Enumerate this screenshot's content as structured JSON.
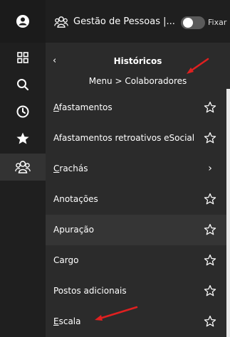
{
  "rail": {
    "items": [
      {
        "name": "profile-icon"
      },
      {
        "name": "apps-grid-icon"
      },
      {
        "name": "search-icon"
      },
      {
        "name": "history-clock-icon"
      },
      {
        "name": "favorites-star-icon"
      },
      {
        "name": "people-group-icon"
      }
    ]
  },
  "header": {
    "app_title": "Gestão de Pessoas |...",
    "pin_label": "Fixar"
  },
  "nav": {
    "back": "‹",
    "title": "Históricos",
    "breadcrumb": "Menu  > Colaboradores"
  },
  "menu": {
    "items": [
      {
        "first": "A",
        "rest": "fastamentos",
        "action": "star-outline-icon"
      },
      {
        "first": "",
        "rest": "Afastamentos retroativos eSocial",
        "action": "star-outline-icon"
      },
      {
        "first": "C",
        "rest": "rachás",
        "action": "chevron-right-icon",
        "chevron": "›"
      },
      {
        "first": "",
        "rest": "Anotações",
        "action": "star-outline-icon"
      },
      {
        "first": "",
        "rest": "Apuração",
        "action": "star-outline-icon",
        "active": true
      },
      {
        "first": "",
        "rest": "Cargo",
        "action": "star-outline-icon"
      },
      {
        "first": "",
        "rest": "Postos adicionais",
        "action": "star-outline-icon"
      },
      {
        "first": "E",
        "rest": "scala",
        "action": "star-outline-icon"
      }
    ]
  },
  "colors": {
    "rail_bg": "#1f1f1f",
    "panel_bg": "#2b2b2b",
    "active_bg": "#353535",
    "annotation_red": "#e02020"
  }
}
